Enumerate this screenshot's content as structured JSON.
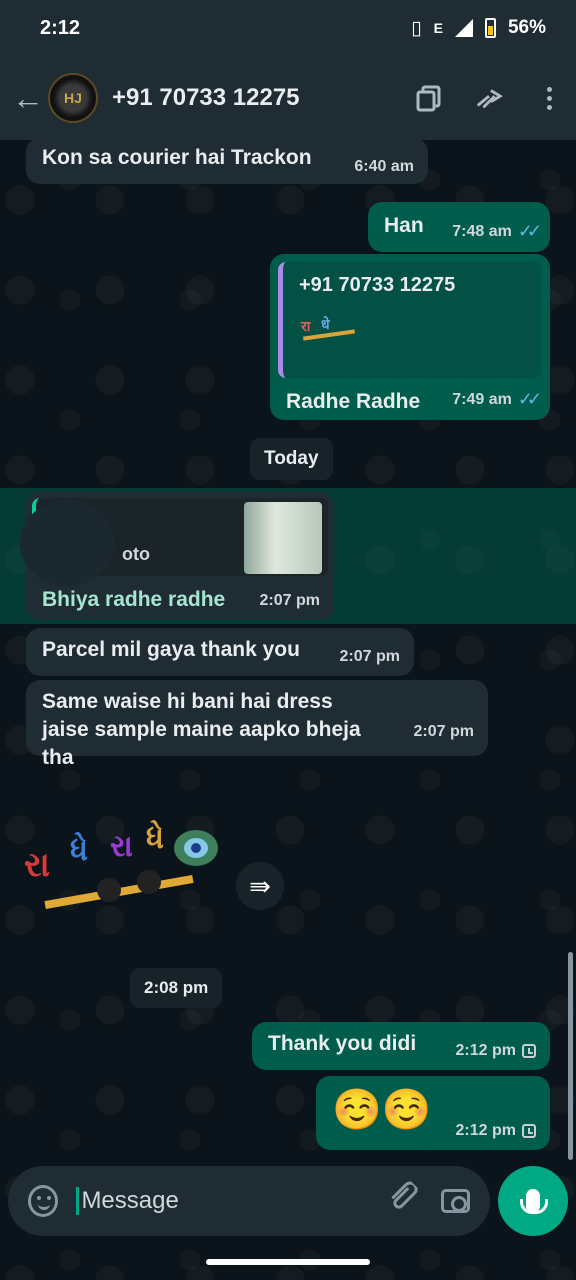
{
  "status_bar": {
    "time": "2:12",
    "network": "E",
    "battery": "56%"
  },
  "header": {
    "avatar_text": "HJ",
    "contact": "+91 70733 12275"
  },
  "messages": [
    {
      "text": "Kon sa courier hai Trackon",
      "time": "6:40 am"
    },
    {
      "text": "Han",
      "time": "7:48 am"
    },
    {
      "contact_card_number": "+91 70733 12275",
      "text": "Radhe Radhe",
      "time": "7:49 am"
    },
    {
      "quoted_label": "oto",
      "text": "Bhiya radhe radhe",
      "time": "2:07 pm"
    },
    {
      "text": "Parcel mil gaya thank you",
      "time": "2:07 pm"
    },
    {
      "text": "Same waise hi bani hai dress jaise sample maine aapko bheja tha",
      "time": "2:07 pm"
    },
    {
      "sticker_text": "રાધે રાધે",
      "time": "2:08 pm"
    },
    {
      "text": "Thank you didi",
      "time": "2:12 pm"
    },
    {
      "text": "☺️☺️",
      "time": "2:12 pm"
    }
  ],
  "date_divider": "Today",
  "input": {
    "placeholder": "Message"
  },
  "colors": {
    "incoming_bubble": "#202c33",
    "outgoing_bubble": "#005c4b",
    "accent": "#00a884",
    "read_ticks": "#53bdeb"
  }
}
